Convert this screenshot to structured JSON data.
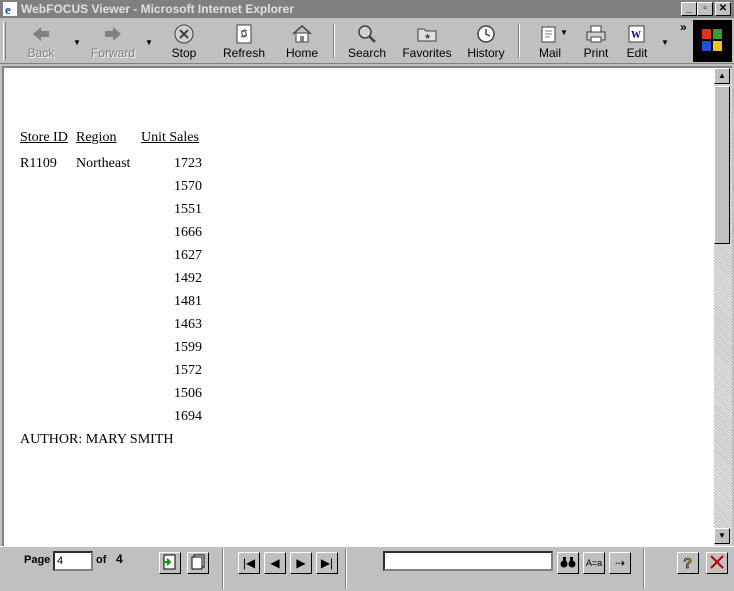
{
  "window": {
    "title": "WebFOCUS Viewer - Microsoft Internet Explorer"
  },
  "toolbar": {
    "back": "Back",
    "forward": "Forward",
    "stop": "Stop",
    "refresh": "Refresh",
    "home": "Home",
    "search": "Search",
    "favorites": "Favorites",
    "history": "History",
    "mail": "Mail",
    "print": "Print",
    "edit": "Edit",
    "more": "»"
  },
  "report": {
    "headers": {
      "store_id": "Store ID",
      "region": "Region",
      "unit_sales": "Unit Sales"
    },
    "store_id": "R1109",
    "region": "Northeast",
    "unit_sales": [
      "1723",
      "1570",
      "1551",
      "1666",
      "1627",
      "1492",
      "1481",
      "1463",
      "1599",
      "1572",
      "1506",
      "1694"
    ],
    "footer": "AUTHOR: MARY SMITH"
  },
  "pager": {
    "page_label": "Page",
    "current_page": "4",
    "of_label": "of",
    "total_pages": "4"
  },
  "colors": {
    "titlebar": "#808080",
    "chrome": "#c0c0c0",
    "close_red": "#c00000"
  }
}
